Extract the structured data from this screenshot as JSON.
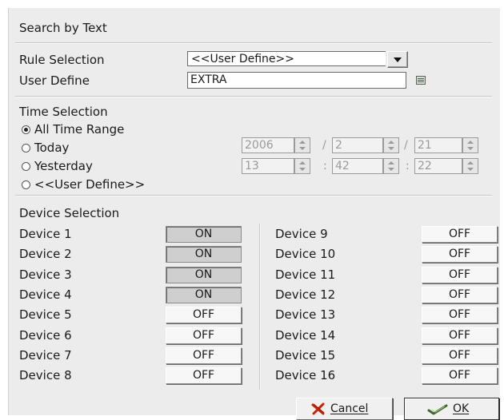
{
  "dialog": {
    "title": "Search by Text"
  },
  "rule": {
    "rule_label": "Rule Selection",
    "rule_value": "<<User Define>>",
    "user_define_label": "User Define",
    "user_define_value": "EXTRA"
  },
  "time": {
    "section_label": "Time Selection",
    "options": [
      {
        "label": "All Time Range",
        "selected": true
      },
      {
        "label": "Today",
        "selected": false
      },
      {
        "label": "Yesterday",
        "selected": false
      },
      {
        "label": "<<User Define>>",
        "selected": false
      }
    ],
    "date": {
      "year": "2006",
      "month": "2",
      "day": "21",
      "sep": "/"
    },
    "clock": {
      "hour": "13",
      "minute": "42",
      "second": "22",
      "sep": ":"
    }
  },
  "devices": {
    "section_label": "Device Selection",
    "left": [
      {
        "name": "Device 1",
        "state": "ON"
      },
      {
        "name": "Device 2",
        "state": "ON"
      },
      {
        "name": "Device 3",
        "state": "ON"
      },
      {
        "name": "Device 4",
        "state": "ON"
      },
      {
        "name": "Device 5",
        "state": "OFF"
      },
      {
        "name": "Device 6",
        "state": "OFF"
      },
      {
        "name": "Device 7",
        "state": "OFF"
      },
      {
        "name": "Device 8",
        "state": "OFF"
      }
    ],
    "right": [
      {
        "name": "Device 9",
        "state": "OFF"
      },
      {
        "name": "Device 10",
        "state": "OFF"
      },
      {
        "name": "Device 11",
        "state": "OFF"
      },
      {
        "name": "Device 12",
        "state": "OFF"
      },
      {
        "name": "Device 13",
        "state": "OFF"
      },
      {
        "name": "Device 14",
        "state": "OFF"
      },
      {
        "name": "Device 15",
        "state": "OFF"
      },
      {
        "name": "Device 16",
        "state": "OFF"
      }
    ]
  },
  "buttons": {
    "cancel_label": "Cancel",
    "ok_label": "OK"
  },
  "icons": {
    "cancel": "red-x-icon",
    "ok": "checkmark-arrow-icon",
    "list": "list-icon",
    "dropdown": "chevron-down-icon"
  },
  "colors": {
    "background": "#ececec",
    "toggle_on": "#cfcfcf",
    "toggle_off": "#f7f7f7",
    "cancel_icon": "#cc2200"
  }
}
